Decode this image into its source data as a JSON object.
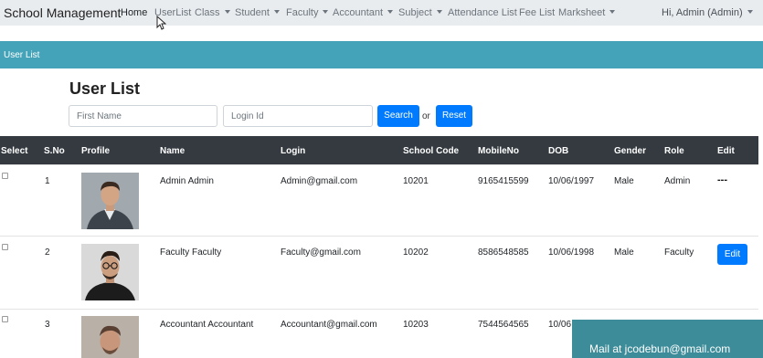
{
  "nav": {
    "brand": "School Management",
    "items": [
      {
        "label": "Home",
        "dropdown": false
      },
      {
        "label": "UserList",
        "dropdown": false
      },
      {
        "label": "Class",
        "dropdown": true
      },
      {
        "label": "Student",
        "dropdown": true
      },
      {
        "label": "Faculty",
        "dropdown": true
      },
      {
        "label": "Accountant",
        "dropdown": true
      },
      {
        "label": "Subject",
        "dropdown": true
      },
      {
        "label": "Attendance List",
        "dropdown": false
      },
      {
        "label": "Fee List",
        "dropdown": false
      },
      {
        "label": "Marksheet",
        "dropdown": true
      }
    ],
    "user": "Hi, Admin (Admin)"
  },
  "banner": {
    "title": "User List"
  },
  "page": {
    "title": "User List",
    "search": {
      "first_name_placeholder": "First Name",
      "login_placeholder": "Login Id",
      "search_label": "Search",
      "or_label": "or",
      "reset_label": "Reset"
    }
  },
  "table": {
    "headers": [
      "Select",
      "S.No",
      "Profile",
      "Name",
      "Login",
      "School Code",
      "MobileNo",
      "DOB",
      "Gender",
      "Role",
      "Edit"
    ],
    "rows": [
      {
        "sno": "1",
        "name": "Admin Admin",
        "login": "Admin@gmail.com",
        "school_code": "10201",
        "mobile": "9165415599",
        "dob": "10/06/1997",
        "gender": "Male",
        "role": "Admin",
        "edit": "---",
        "avatar": "admin-avatar"
      },
      {
        "sno": "2",
        "name": "Faculty Faculty",
        "login": "Faculty@gmail.com",
        "school_code": "10202",
        "mobile": "8586548585",
        "dob": "10/06/1998",
        "gender": "Male",
        "role": "Faculty",
        "edit": "Edit",
        "avatar": "faculty-avatar"
      },
      {
        "sno": "3",
        "name": "Accountant Accountant",
        "login": "Accountant@gmail.com",
        "school_code": "10203",
        "mobile": "7544564565",
        "dob": "10/06",
        "gender": "",
        "role": "",
        "edit": "",
        "avatar": "accountant-avatar"
      }
    ]
  },
  "overlay": {
    "mail": "Mail at jcodebun@gmail.com"
  },
  "colors": {
    "navbar": "#e9ecef",
    "banner": "#44a3b8",
    "primary": "#007bff",
    "table_header": "#343a40",
    "mail_overlay": "#3d8c99"
  }
}
